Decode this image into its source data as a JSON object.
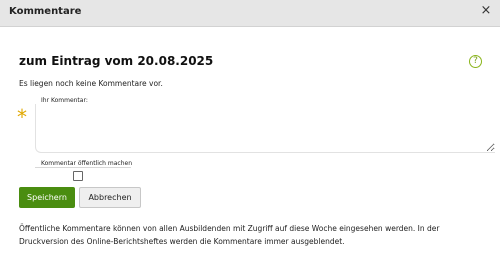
{
  "dialog": {
    "title": "Kommentare",
    "close_symbol": "×"
  },
  "content": {
    "heading": "zum Eintrag vom 20.08.2025",
    "help_symbol": "?",
    "no_comments_text": "Es liegen noch keine Kommentare vor.",
    "comment_label": "Ihr Kommentar:",
    "comment_value": "",
    "required_symbol": "*",
    "public_label": "Kommentar öffentlich machen",
    "public_checked": false,
    "info_text": "Öffentliche Kommentare können von allen Ausbildenden mit Zugriff auf diese Woche eingesehen werden. In der Druckversion des Online-Berichtsheftes werden die Kommentare immer ausgeblendet."
  },
  "buttons": {
    "save_label": "Speichern",
    "cancel_label": "Abbrechen"
  },
  "colors": {
    "save_button": "#4a8d10",
    "required_star": "#e0a800",
    "help_icon": "#8ab51c",
    "titlebar": "#e6e6e6"
  },
  "icons": {
    "close": "close-icon",
    "help": "help-icon",
    "required": "required-star-icon"
  }
}
